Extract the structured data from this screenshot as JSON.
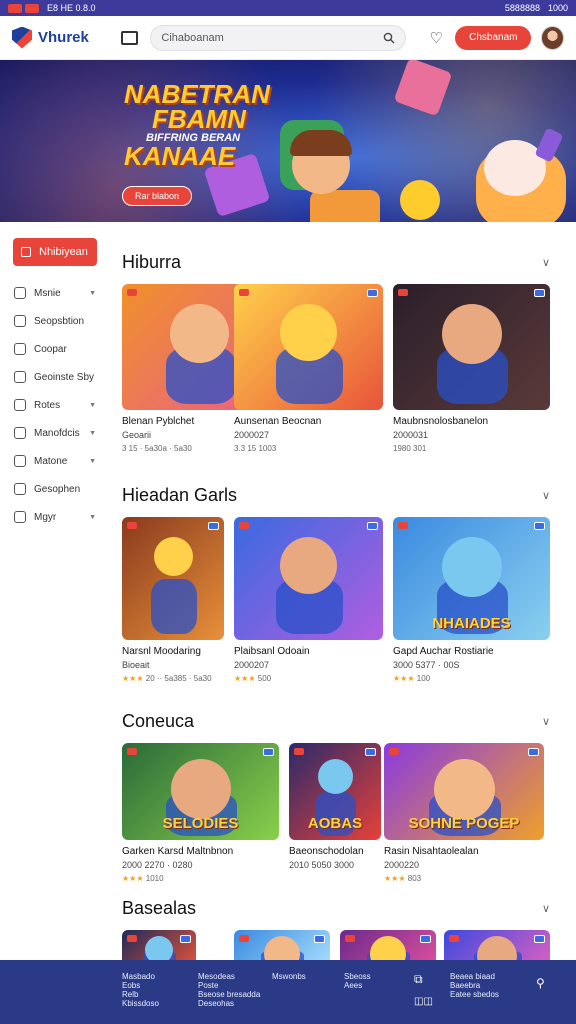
{
  "statusbar": {
    "time": "E8 HE 0.8.0",
    "right_text": "5888888",
    "battery": "1000"
  },
  "header": {
    "logo": "Vhurek",
    "search_placeholder": "Cihaboanam",
    "login_label": "Chsbanam"
  },
  "hero": {
    "title_line1": "NABETRAN",
    "title_line2": "FBAMN",
    "title_sub": "BIFFRING BERAN",
    "title_line3": "KANAAE",
    "button_label": "Rar blabon"
  },
  "sidebar": {
    "active_label": "Nhibiyean",
    "items": [
      {
        "label": "Msnie",
        "icon": "gamepad-icon",
        "caret": true
      },
      {
        "label": "Seopsbtion",
        "icon": "clipboard-icon",
        "caret": false
      },
      {
        "label": "Coopar",
        "icon": "clock-icon",
        "caret": false
      },
      {
        "label": "Geoinste Sby",
        "icon": "calendar-icon",
        "caret": false
      },
      {
        "label": "Rotes",
        "icon": "chart-icon",
        "caret": true
      },
      {
        "label": "Manofdcis",
        "icon": "heart-icon",
        "caret": true
      },
      {
        "label": "Matone",
        "icon": "tag-icon",
        "caret": true
      },
      {
        "label": "Gesophen",
        "icon": "users-icon",
        "caret": false
      },
      {
        "label": "Mgyr",
        "icon": "palette-icon",
        "caret": true
      }
    ]
  },
  "sections": [
    {
      "title": "Hiburra",
      "cards": [
        {
          "title": "Blenan Pyblchet",
          "sub": "Geoarii",
          "meta": "3 15 · 5a30a · 5a30"
        },
        {
          "title": "Aunsenan Beocnan",
          "sub": "2000027",
          "meta": "3.3 15 1003"
        },
        {
          "title": "Maubnsnolosbanelon",
          "sub": "2000031",
          "meta": "1980 301"
        }
      ]
    },
    {
      "title": "Hieadan Garls",
      "cards": [
        {
          "title": "Narsnl Moodaring",
          "sub": "Bioeait",
          "meta": "20 ·· 5a385 · 5a30"
        },
        {
          "title": "Plaibsanl Odoain",
          "sub": "2000207",
          "meta": "500"
        },
        {
          "title": "Gapd Auchar Rostiarie",
          "sub": "3000 5377 · 00S",
          "meta": "100",
          "overlay": "NHAIADES"
        }
      ]
    },
    {
      "title": "Coneuca",
      "cards": [
        {
          "title": "Garken Karsd Maltnbnon",
          "sub": "2000 2270 · 0280",
          "meta": "1010",
          "overlay": "SELODIES"
        },
        {
          "title": "Baeonschodolan",
          "sub": "2010 5050 3000",
          "meta": "",
          "overlay": "AOBAS"
        },
        {
          "title": "Rasin Nisahtaolealan",
          "sub": "2000220",
          "meta": "803",
          "overlay": "SOHNE POGEP"
        }
      ]
    },
    {
      "title": "Basealas",
      "cards": []
    }
  ],
  "footer": {
    "col1": [
      "Masbado",
      "Eobs",
      "Relb",
      "Kbissdoso"
    ],
    "col2": [
      "Mesodeas",
      "Poste",
      "Bseose bresadda",
      "Deseohas"
    ],
    "col3": [
      "Mswonbs"
    ],
    "col4": [
      "Sbeoss",
      "Aees"
    ],
    "col5": [
      "Beaea biaad",
      "Baeebra",
      "Eatee sbedos"
    ]
  },
  "colors": {
    "accent": "#e8443a",
    "brand": "#1f3f9a",
    "footer": "#2b3a86"
  }
}
